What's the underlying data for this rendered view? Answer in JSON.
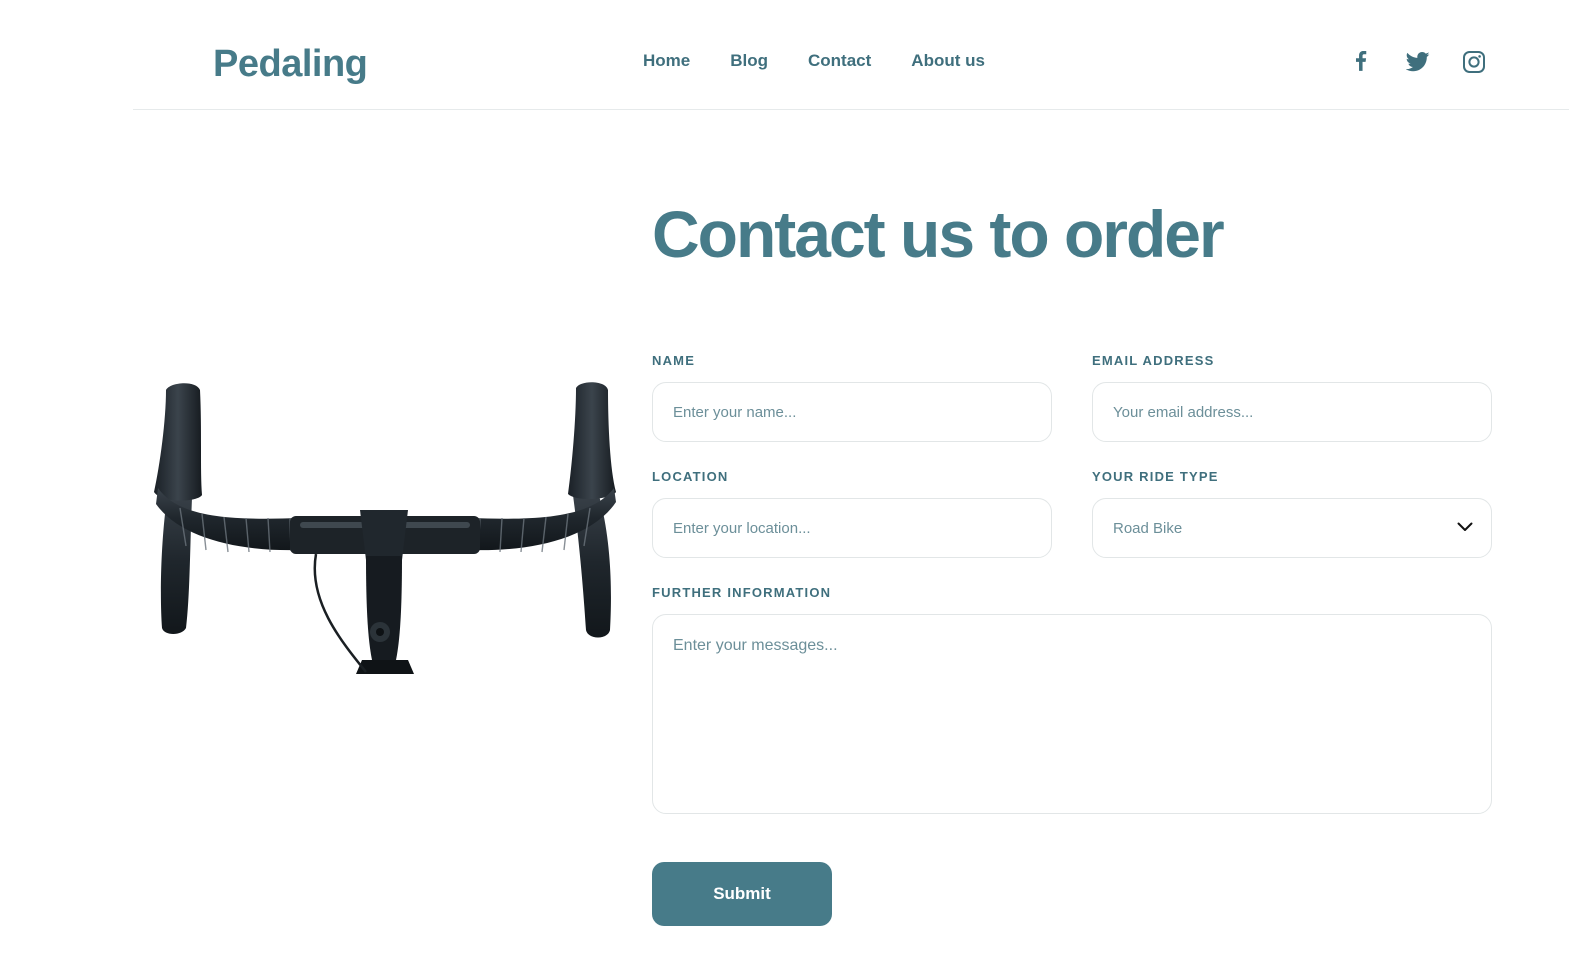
{
  "brand": {
    "name": "Pedaling"
  },
  "nav": {
    "items": [
      "Home",
      "Blog",
      "Contact",
      "About us"
    ]
  },
  "social": {
    "icons": [
      "facebook-icon",
      "twitter-icon",
      "instagram-icon"
    ]
  },
  "page": {
    "title": "Contact us to order"
  },
  "form": {
    "name": {
      "label": "NAME",
      "placeholder": "Enter your name..."
    },
    "email": {
      "label": "EMAIL ADDRESS",
      "placeholder": "Your email address..."
    },
    "location": {
      "label": "LOCATION",
      "placeholder": "Enter your location..."
    },
    "ride_type": {
      "label": "YOUR RIDE TYPE",
      "value": "Road Bike"
    },
    "message": {
      "label": "FURTHER INFORMATION",
      "placeholder": "Enter your messages..."
    },
    "submit_label": "Submit"
  },
  "colors": {
    "accent": "#477b89",
    "text": "#3f6f7d",
    "border": "#e2e6e7"
  }
}
